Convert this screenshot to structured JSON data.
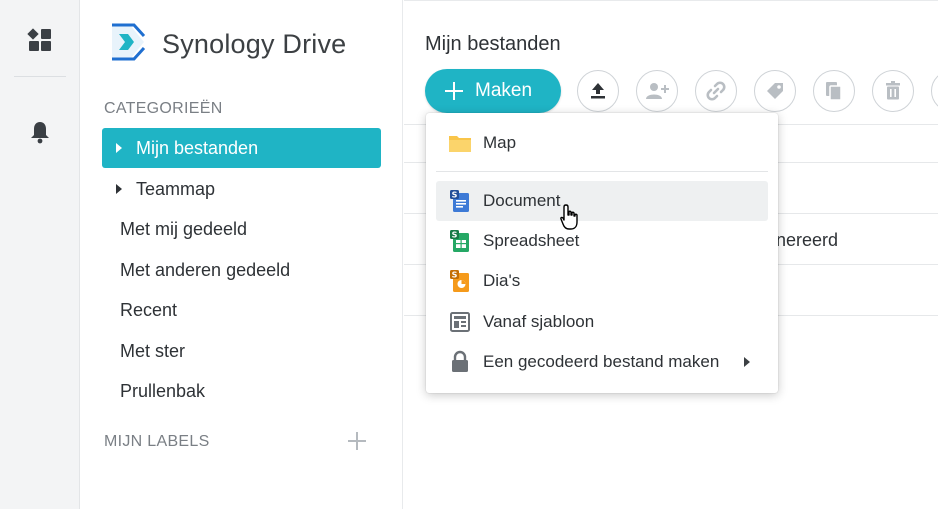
{
  "app": {
    "name": "Synology Drive"
  },
  "rail": {
    "icons": [
      "dashboard-icon",
      "bell-icon"
    ]
  },
  "sidebar": {
    "categories_title": "CATEGORIEËN",
    "items": [
      {
        "label": "Mijn bestanden",
        "active": true,
        "expandable": true
      },
      {
        "label": "Teammap",
        "active": false,
        "expandable": true
      },
      {
        "label": "Met mij gedeeld",
        "active": false,
        "expandable": false
      },
      {
        "label": "Met anderen gedeeld",
        "active": false,
        "expandable": false
      },
      {
        "label": "Recent",
        "active": false,
        "expandable": false
      },
      {
        "label": "Met ster",
        "active": false,
        "expandable": false
      },
      {
        "label": "Prullenbak",
        "active": false,
        "expandable": false
      }
    ],
    "labels_title": "MIJN LABELS"
  },
  "main": {
    "title": "Mijn bestanden",
    "create_label": "Maken",
    "toolbar_icons": [
      "upload-icon",
      "share-user-icon",
      "link-icon",
      "tag-icon",
      "copy-icon",
      "delete-icon"
    ],
    "partial_row_text": "nereerd"
  },
  "menu": {
    "items": [
      {
        "label": "Map",
        "icon": "folder-icon"
      },
      {
        "label": "Document",
        "icon": "synology-document-icon",
        "hover": true
      },
      {
        "label": "Spreadsheet",
        "icon": "synology-spreadsheet-icon"
      },
      {
        "label": "Dia's",
        "icon": "synology-slides-icon"
      },
      {
        "label": "Vanaf sjabloon",
        "icon": "template-icon"
      },
      {
        "label": "Een gecodeerd bestand maken",
        "icon": "lock-icon",
        "submenu": true
      }
    ]
  },
  "colors": {
    "accent": "#1fb4c5",
    "doc": "#3d7ad6",
    "sheet": "#25a865",
    "slides": "#f59a1b",
    "folder": "#f9c54a"
  }
}
